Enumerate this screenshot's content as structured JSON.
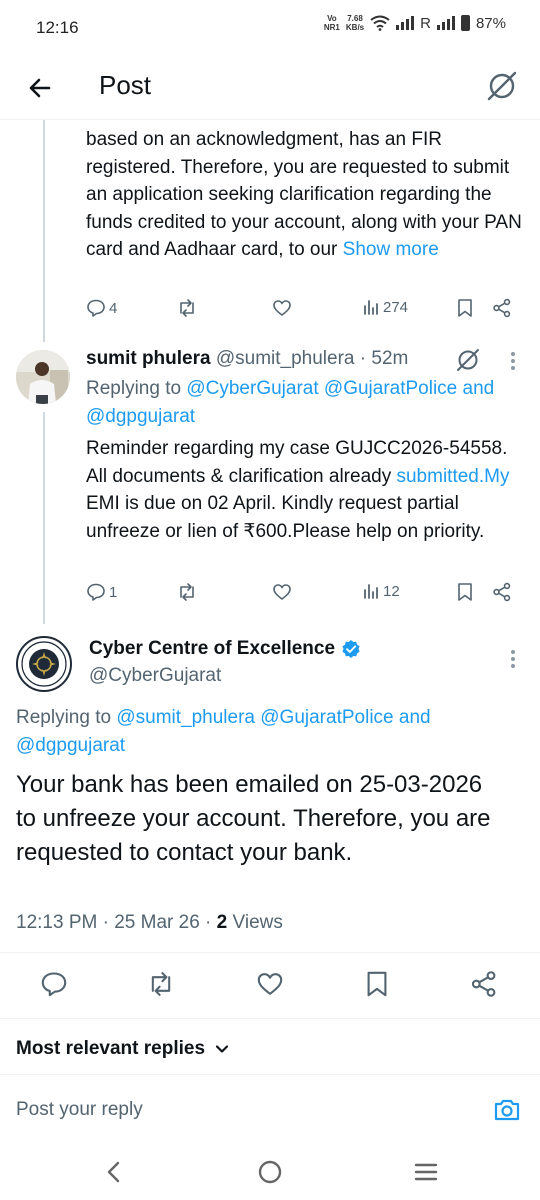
{
  "status_bar": {
    "time": "12:16",
    "net_top": "Vo",
    "net_bottom": "NR1",
    "speed_top": "7.68",
    "speed_bottom": "KB/s",
    "roaming": "R",
    "battery": "87%"
  },
  "header": {
    "title": "Post"
  },
  "post_prev": {
    "text": "based on an acknowledgment, has an FIR registered. Therefore, you are requested to submit an application seeking clarification regarding the funds credited to your account, along with your PAN card and Aadhaar card, to our",
    "show_more": "Show more",
    "replies": "4",
    "views": "274"
  },
  "reply_tweet": {
    "name": "sumit phulera",
    "handle": "@sumit_phulera",
    "time": "· 52m",
    "replying_label": "Replying to",
    "replying_to1": "@CyberGujarat",
    "replying_to2": "@GujaratPolice",
    "replying_and": "and",
    "replying_to3": "@dgpgujarat",
    "text_part1": "Reminder regarding my case GUJCC2026-54558. All documents & clarification already",
    "text_link": "submitted.My",
    "text_part2": "EMI is due on 02 April. Kindly request partial unfreeze or lien of ₹600.Please help on priority.",
    "replies": "1",
    "views": "12"
  },
  "main_tweet": {
    "name": "Cyber Centre of Excellence",
    "handle": "@CyberGujarat",
    "replying_label": "Replying to",
    "replying_to1": "@sumit_phulera",
    "replying_to2": "@GujaratPolice",
    "replying_and": "and",
    "replying_to3": "@dgpgujarat",
    "text": "Your bank has been emailed on 25-03-2026 to unfreeze your account. Therefore, you are requested to contact your bank.",
    "timestamp": "12:13 PM · 25 Mar 26 ·",
    "views_count": "2",
    "views_label": "Views"
  },
  "replies_sort": {
    "label": "Most relevant replies"
  },
  "reply_box": {
    "placeholder": "Post your reply"
  },
  "colors": {
    "link": "#1d9bf0",
    "muted": "#536471",
    "verified": "#1d9bf0"
  }
}
